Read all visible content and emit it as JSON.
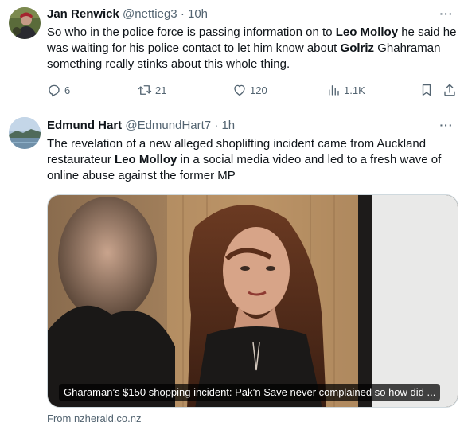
{
  "tweets": [
    {
      "author": {
        "name": "Jan Renwick",
        "handle": "@nettieg3"
      },
      "separator": "·",
      "time": "10h",
      "text": [
        {
          "t": "So who in the police force is passing information on to "
        },
        {
          "t": "Leo Molloy",
          "bold": true
        },
        {
          "t": " he said he was waiting for his police contact to let him know about "
        },
        {
          "t": "Golriz",
          "bold": true
        },
        {
          "t": " Ghahraman something really stinks about this whole thing."
        }
      ],
      "stats": {
        "replies": "6",
        "retweets": "21",
        "likes": "120",
        "views": "1.1K"
      }
    },
    {
      "author": {
        "name": "Edmund Hart",
        "handle": "@EdmundHart7"
      },
      "separator": "·",
      "time": "1h",
      "text": [
        {
          "t": "The revelation of a new alleged shoplifting incident came from Auckland restaurateur "
        },
        {
          "t": "Leo Molloy",
          "bold": true
        },
        {
          "t": " in a social media video and led to a fresh wave of online abuse against the former MP"
        }
      ],
      "card": {
        "caption": "Gharaman’s $150 shopping incident: Pak’n Save never complained so how did ...",
        "source": "From nzherald.co.nz"
      }
    }
  ],
  "icons": {
    "more": "more-dots-icon",
    "reply": "reply-icon",
    "retweet": "retweet-icon",
    "like": "heart-icon",
    "views": "views-chart-icon",
    "bookmark": "bookmark-icon",
    "share": "share-icon"
  },
  "colors": {
    "text": "#0f1419",
    "secondary": "#536471",
    "border": "#eff3f4"
  }
}
